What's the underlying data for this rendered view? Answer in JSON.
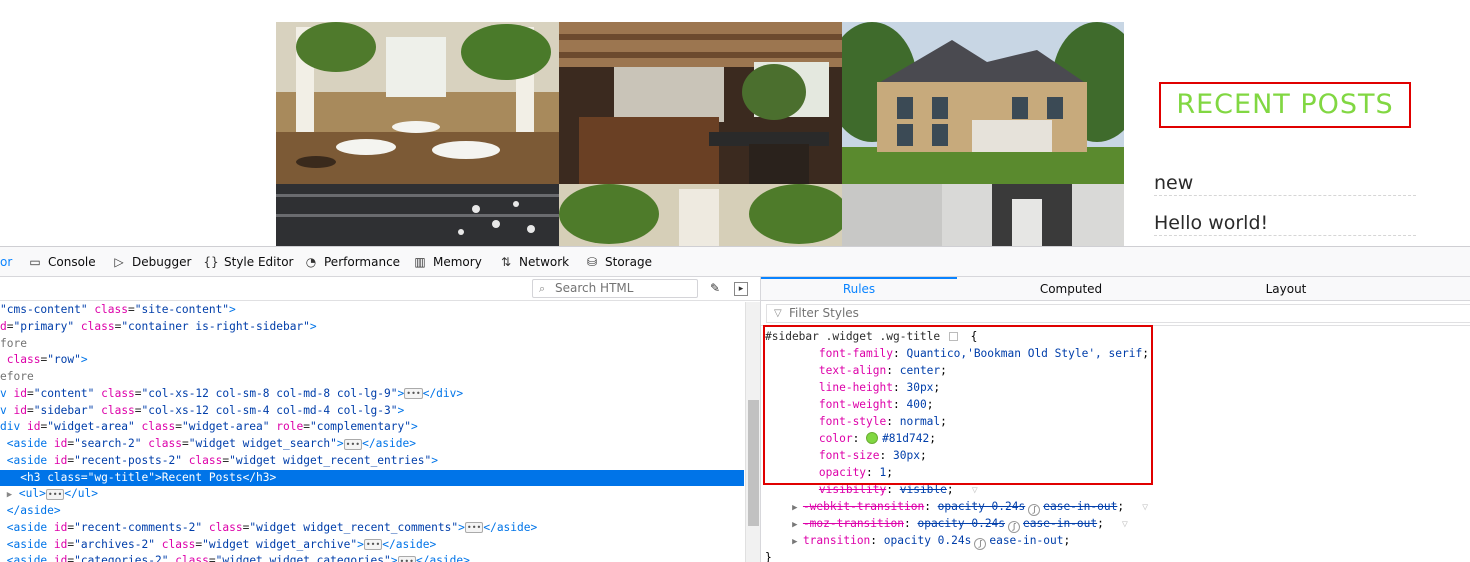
{
  "site": {
    "recent_posts_title": "RECENT POSTS",
    "posts": [
      "new",
      "Hello world!"
    ]
  },
  "devtools": {
    "tabs": [
      {
        "label": "or",
        "icon": ""
      },
      {
        "label": "Console",
        "icon": "console-icon"
      },
      {
        "label": "Debugger",
        "icon": "debugger-icon"
      },
      {
        "label": "Style Editor",
        "icon": "style-editor-icon"
      },
      {
        "label": "Performance",
        "icon": "performance-icon"
      },
      {
        "label": "Memory",
        "icon": "memory-icon"
      },
      {
        "label": "Network",
        "icon": "network-icon"
      },
      {
        "label": "Storage",
        "icon": "storage-icon"
      }
    ],
    "search_html_placeholder": "Search HTML",
    "side_tabs": [
      "Rules",
      "Computed",
      "Layout"
    ],
    "active_side_tab": "Rules",
    "filter_placeholder": "Filter Styles"
  },
  "markup": [
    {
      "html": "<span class=\"av\">\"cms-content\"</span> <span class=\"at\">class</span>=<span class=\"av\">\"site-content\"</span><span class=\"tg\">&gt;</span>"
    },
    {
      "html": "<span class=\"at\">d</span>=<span class=\"av\">\"primary\"</span> <span class=\"at\">class</span>=<span class=\"av\">\"container is-right-sidebar\"</span><span class=\"tg\">&gt;</span>"
    },
    {
      "html": "<span class=\"pl\">fore</span>"
    },
    {
      "html": " <span class=\"at\">class</span>=<span class=\"av\">\"row\"</span><span class=\"tg\">&gt;</span>"
    },
    {
      "html": "<span class=\"pl\">efore</span>"
    },
    {
      "html": "<span class=\"tg\">v</span> <span class=\"at\">id</span>=<span class=\"av\">\"content\"</span> <span class=\"at\">class</span>=<span class=\"av\">\"col-xs-12 col-sm-8 col-md-8 col-lg-9\"</span><span class=\"tg\">&gt;</span><span class=\"ell\">•••</span><span class=\"tg\">&lt;/div&gt;</span>"
    },
    {
      "html": "<span class=\"tg\">v</span> <span class=\"at\">id</span>=<span class=\"av\">\"sidebar\"</span> <span class=\"at\">class</span>=<span class=\"av\">\"col-xs-12 col-sm-4 col-md-4 col-lg-3\"</span><span class=\"tg\">&gt;</span>"
    },
    {
      "html": "<span class=\"tg\">div</span> <span class=\"at\">id</span>=<span class=\"av\">\"widget-area\"</span> <span class=\"at\">class</span>=<span class=\"av\">\"widget-area\"</span> <span class=\"at\">role</span>=<span class=\"av\">\"complementary\"</span><span class=\"tg\">&gt;</span>"
    },
    {
      "html": " <span class=\"tg\">&lt;aside</span> <span class=\"at\">id</span>=<span class=\"av\">\"search-2\"</span> <span class=\"at\">class</span>=<span class=\"av\">\"widget widget_search\"</span><span class=\"tg\">&gt;</span><span class=\"ell\">•••</span><span class=\"tg\">&lt;/aside&gt;</span>"
    },
    {
      "html": " <span class=\"tg\">&lt;aside</span> <span class=\"at\">id</span>=<span class=\"av\">\"recent-posts-2\"</span> <span class=\"at\">class</span>=<span class=\"av\">\"widget widget_recent_entries\"</span><span class=\"tg\">&gt;</span>"
    },
    {
      "html": "   <span class=\"tg\">&lt;h3</span> <span class=\"at\">class</span>=<span class=\"av\">\"wg-title\"</span><span class=\"tg\">&gt;</span>Recent Posts<span class=\"tg\">&lt;/h3&gt;</span>",
      "selected": true
    },
    {
      "html": " <span class=\"tw\">▶</span> <span class=\"tg\">&lt;ul&gt;</span><span class=\"ell\">•••</span><span class=\"tg\">&lt;/ul&gt;</span>"
    },
    {
      "html": " <span class=\"tg\">&lt;/aside&gt;</span>"
    },
    {
      "html": " <span class=\"tg\">&lt;aside</span> <span class=\"at\">id</span>=<span class=\"av\">\"recent-comments-2\"</span> <span class=\"at\">class</span>=<span class=\"av\">\"widget widget_recent_comments\"</span><span class=\"tg\">&gt;</span><span class=\"ell\">•••</span><span class=\"tg\">&lt;/aside&gt;</span>"
    },
    {
      "html": " <span class=\"tg\">&lt;aside</span> <span class=\"at\">id</span>=<span class=\"av\">\"archives-2\"</span> <span class=\"at\">class</span>=<span class=\"av\">\"widget widget_archive\"</span><span class=\"tg\">&gt;</span><span class=\"ell\">•••</span><span class=\"tg\">&lt;/aside&gt;</span>"
    },
    {
      "html": " <span class=\"tg\">&lt;aside</span> <span class=\"at\">id</span>=<span class=\"av\">\"categories-2\"</span> <span class=\"at\">class</span>=<span class=\"av\">\"widget widget_categories\"</span><span class=\"tg\">&gt;</span><span class=\"ell\">•••</span><span class=\"tg\">&lt;/aside&gt;</span>"
    }
  ],
  "rule": {
    "selector": "#sidebar .widget .wg-title",
    "declarations": [
      {
        "name": "font-family",
        "value": "Quantico,'Bookman Old Style', serif"
      },
      {
        "name": "text-align",
        "value": "center"
      },
      {
        "name": "line-height",
        "value": "30px"
      },
      {
        "name": "font-weight",
        "value": "400"
      },
      {
        "name": "font-style",
        "value": "normal"
      },
      {
        "name": "color",
        "value": "#81d742",
        "swatch": "#81d742"
      },
      {
        "name": "font-size",
        "value": "30px"
      },
      {
        "name": "opacity",
        "value": "1"
      },
      {
        "name": "visibility",
        "value": "visible",
        "overridden": true
      },
      {
        "name": "-webkit-transition",
        "value": "opacity 0.24s",
        "easing": "ease-in-out",
        "overridden": true,
        "expandable": true
      },
      {
        "name": "-moz-transition",
        "value": "opacity 0.24s",
        "easing": "ease-in-out",
        "overridden": true,
        "expandable": true
      },
      {
        "name": "transition",
        "value": "opacity 0.24s",
        "easing": "ease-in-out",
        "expandable": true
      }
    ],
    "closing": "}"
  },
  "colors": {
    "accent_green": "#81d742",
    "highlight_red": "#e00000",
    "selection_blue": "#0074e8"
  }
}
